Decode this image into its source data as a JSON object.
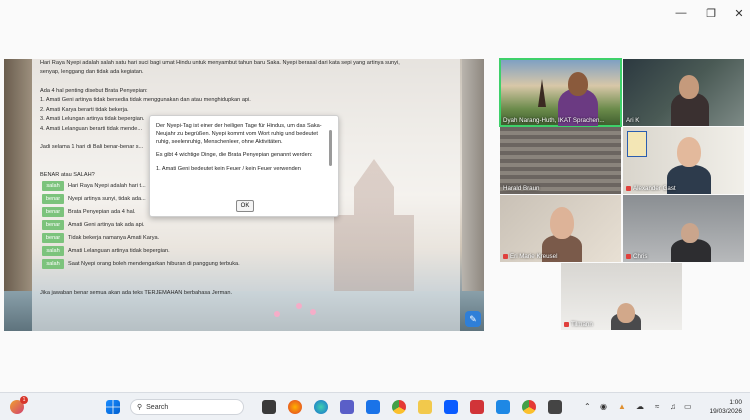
{
  "slide": {
    "p1": [
      "Hari Raya Nyepi adalah salah satu hari suci bagi umat Hindu untuk menyambut tahun baru Saka. Nyepi berasal dari kata sepi yang artinya sunyi,",
      "senyap, lenggang dan tidak ada kegiatan."
    ],
    "p2": [
      "Ada 4 hal penting disebut Brata Penyepian:",
      "1. Amati Geni artinya tidak bersedia tidak menggunakan dan atau menghidupkan api.",
      "2. Amati Karya berarti tidak bekerja.",
      "3. Amati Lelungan artinya tidak bepergian.",
      "4. Amati Lelanguan berarti tidak mende..."
    ],
    "p3": "Jadi selama 1 hari di Bali benar-benar s...",
    "p4": "BENAR atau SALAH?",
    "rows": [
      {
        "btn": "salah",
        "text": "Hari Raya Nyepi adalah hari t..."
      },
      {
        "btn": "benar",
        "text": "Nyepi artinya sunyi, tidak ada..."
      },
      {
        "btn": "benar",
        "text": "Brata Penyepian ada 4 hal."
      },
      {
        "btn": "benar",
        "text": "Amati Geni artinya tak ada api."
      },
      {
        "btn": "benar",
        "text": "Tidak bekerja namanya Amati Karya."
      },
      {
        "btn": "salah",
        "text": "Amati Lelanguan artinya tidak bepergian."
      },
      {
        "btn": "salah",
        "text": "Saat Nyepi orang boleh mendengarkan hiburan di panggung terbuka."
      }
    ],
    "p5": "Jika jawaban benar semua akan ada teks TERJEMAHAN berbahasa Jerman."
  },
  "dialog": {
    "p1": "Der Nyepi-Tag ist einer der heiligen Tage für Hindus, um das Saka-Neujahr zu begrüßen. Nyepi kommt vom Wort ruhig und bedeutet ruhig, seelenruhig, Menschenleer, ohne Aktivitäten.",
    "p2": "Es gibt 4 wichtige Dinge, die Brata Penyepian genannt werden:",
    "p3": "1. Amati Geni bedeutet kein Feuer / kein Feuer verwenden",
    "ok": "OK"
  },
  "participants": [
    {
      "name": "Dyah Narang-Huth, IKAT Sprachen..."
    },
    {
      "name": "Ari K"
    },
    {
      "name": "Harald Braun"
    },
    {
      "name": "Alexander Gast"
    },
    {
      "name": "Eri Marie Kreusel"
    },
    {
      "name": "Chris"
    },
    {
      "name": "Tilmann"
    }
  ],
  "taskbar": {
    "search": "Search",
    "time": "1:00",
    "date": "19/03/2026",
    "badge": "1"
  },
  "icons": [
    "minimize-icon",
    "maximize-icon",
    "close-icon",
    "windows-start-icon",
    "search-icon",
    "edit-icon",
    "mic-muted-icon"
  ],
  "colors": {
    "accent": "#7cc37c",
    "active_speaker": "#3ed06a",
    "edit_button": "#2f7fd8"
  }
}
